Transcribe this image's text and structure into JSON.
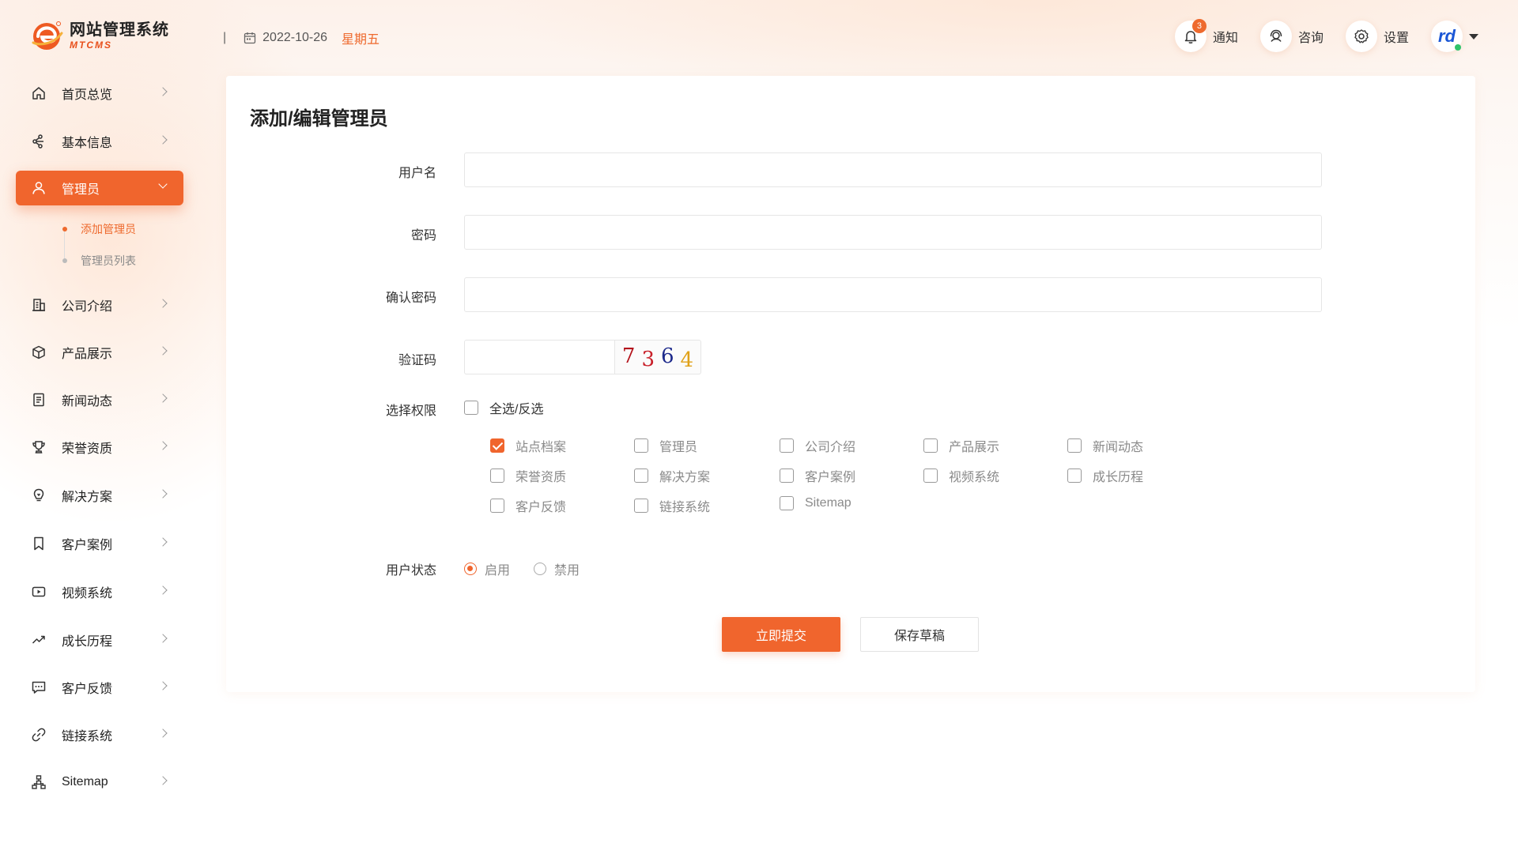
{
  "brand": {
    "title": "网站管理系统",
    "subtitle": "MTCMS",
    "accent_color": "#f0652d"
  },
  "header": {
    "date": "2022-10-26",
    "weekday": "星期五",
    "separator": "|",
    "notify": {
      "label": "通知",
      "count": "3",
      "icon": "bell-icon"
    },
    "consult": {
      "label": "咨询",
      "icon": "headset-icon"
    },
    "settings": {
      "label": "设置",
      "icon": "gear-icon"
    },
    "avatar_text": "rd"
  },
  "sidebar": {
    "items": [
      {
        "label": "首页总览",
        "icon": "home-icon"
      },
      {
        "label": "基本信息",
        "icon": "network-icon"
      },
      {
        "label": "管理员",
        "icon": "user-icon",
        "active": true
      },
      {
        "label": "公司介绍",
        "icon": "building-icon"
      },
      {
        "label": "产品展示",
        "icon": "box-icon"
      },
      {
        "label": "新闻动态",
        "icon": "document-icon"
      },
      {
        "label": "荣誉资质",
        "icon": "trophy-icon"
      },
      {
        "label": "解决方案",
        "icon": "lightbulb-icon"
      },
      {
        "label": "客户案例",
        "icon": "bookmark-icon"
      },
      {
        "label": "视频系统",
        "icon": "video-icon"
      },
      {
        "label": "成长历程",
        "icon": "trend-icon"
      },
      {
        "label": "客户反馈",
        "icon": "message-icon"
      },
      {
        "label": "链接系统",
        "icon": "link-icon"
      },
      {
        "label": "Sitemap",
        "icon": "sitemap-icon"
      }
    ],
    "admin_sub": [
      {
        "label": "添加管理员",
        "active": true
      },
      {
        "label": "管理员列表",
        "active": false
      }
    ]
  },
  "form": {
    "title": "添加/编辑管理员",
    "username_label": "用户名",
    "username_value": "",
    "password_label": "密码",
    "password_value": "",
    "confirm_label": "确认密码",
    "confirm_value": "",
    "captcha_label": "验证码",
    "captcha_value": "",
    "captcha_chars": [
      {
        "ch": "7",
        "color": "#b3121b"
      },
      {
        "ch": "3",
        "color": "#c8202a"
      },
      {
        "ch": "6",
        "color": "#1d2a8c"
      },
      {
        "ch": "4",
        "color": "#e0a21a"
      }
    ],
    "perm_label": "选择权限",
    "select_all_label": "全选/反选",
    "permissions": [
      {
        "label": "站点档案",
        "checked": true
      },
      {
        "label": "管理员",
        "checked": false
      },
      {
        "label": "公司介绍",
        "checked": false
      },
      {
        "label": "产品展示",
        "checked": false
      },
      {
        "label": "新闻动态",
        "checked": false
      },
      {
        "label": "荣誉资质",
        "checked": false
      },
      {
        "label": "解决方案",
        "checked": false
      },
      {
        "label": "客户案例",
        "checked": false
      },
      {
        "label": "视频系统",
        "checked": false
      },
      {
        "label": "成长历程",
        "checked": false
      },
      {
        "label": "客户反馈",
        "checked": false
      },
      {
        "label": "链接系统",
        "checked": false
      },
      {
        "label": "Sitemap",
        "checked": false
      }
    ],
    "status_label": "用户状态",
    "status_enabled": "启用",
    "status_disabled": "禁用",
    "status_selected": "启用",
    "submit_label": "立即提交",
    "draft_label": "保存草稿"
  }
}
